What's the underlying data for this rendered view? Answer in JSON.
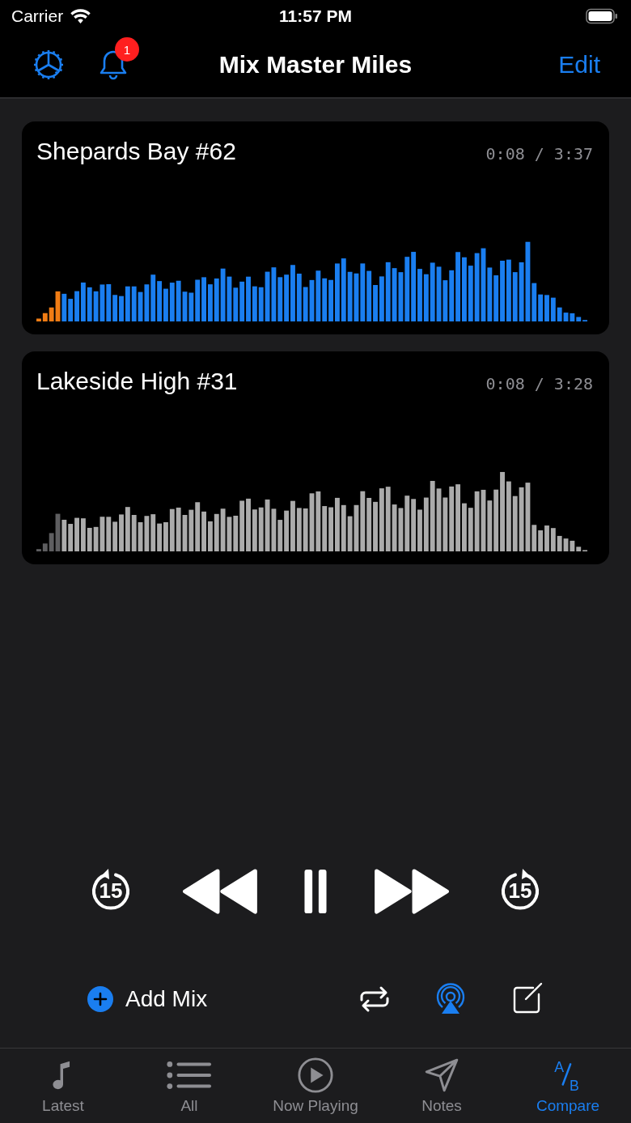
{
  "status_bar": {
    "carrier": "Carrier",
    "time": "11:57 PM"
  },
  "nav": {
    "title": "Mix Master Miles",
    "edit": "Edit",
    "badge": "1"
  },
  "tracks": [
    {
      "title": "Shepards Bay #62",
      "time": "0:08 / 3:37",
      "selected": true,
      "level": 0.04
    },
    {
      "title": "Lakeside High #31",
      "time": "0:08 / 3:28",
      "selected": false,
      "level": 0.04
    }
  ],
  "transport": {
    "skip_seconds_back": "15",
    "skip_seconds_forward": "15",
    "playing": true
  },
  "actions": {
    "add": "Add Mix",
    "airplay_on": true
  },
  "tabs": [
    {
      "kind": "note",
      "label": "Latest",
      "selected": false
    },
    {
      "kind": "list",
      "label": "All",
      "selected": false
    },
    {
      "kind": "play",
      "label": "Now Playing",
      "selected": false
    },
    {
      "kind": "send",
      "label": "Notes",
      "selected": false
    },
    {
      "kind": "ab",
      "label": "Compare",
      "selected": true,
      "letters": [
        "A",
        "B"
      ]
    }
  ]
}
